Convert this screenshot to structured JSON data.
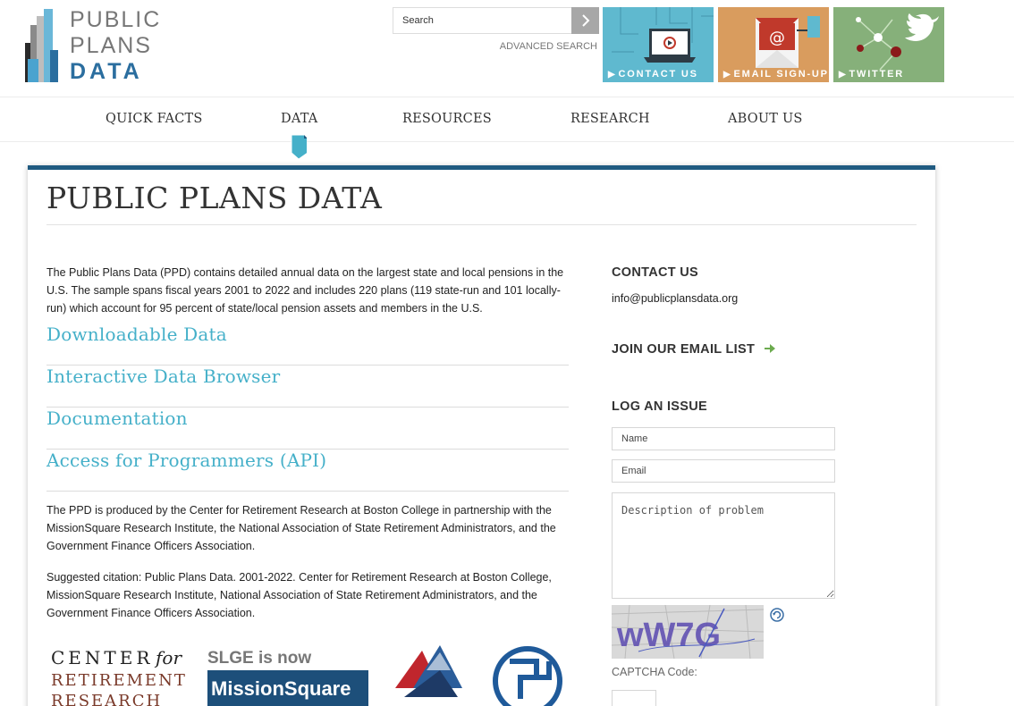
{
  "logo": {
    "line1": "PUBLIC",
    "line2": "PLANS",
    "line3": "DATA"
  },
  "search": {
    "placeholder": "Search",
    "advanced_label": "ADVANCED SEARCH"
  },
  "tiles": [
    {
      "label": "CONTACT US",
      "icon": "laptop-icon"
    },
    {
      "label": "EMAIL SIGN-UP",
      "icon": "envelope-icon"
    },
    {
      "label": "TWITTER",
      "icon": "twitter-bird-icon"
    }
  ],
  "nav": {
    "items": [
      "QUICK FACTS",
      "DATA",
      "RESOURCES",
      "RESEARCH",
      "ABOUT US"
    ],
    "active": "DATA"
  },
  "main": {
    "title": "PUBLIC PLANS DATA",
    "intro": "The Public Plans Data (PPD) contains detailed annual data on the largest state and local pensions in the U.S. The sample spans fiscal years 2001 to 2022 and includes 220 plans (119 state-run and 101 locally-run) which account for 95 percent of state/local pension assets and members in the U.S.",
    "links": [
      "Downloadable Data",
      "Interactive Data Browser",
      "Documentation",
      "Access for Programmers (API)"
    ],
    "credit": "The PPD is produced by the Center for Retirement Research at Boston College in partnership with the MissionSquare Research Institute, the National Association of State Retirement Administrators, and the Government Finance Officers Association.",
    "citation": "Suggested citation: Public Plans Data. 2001-2022. Center for Retirement Research at Boston College, MissionSquare Research Institute, National Association of State Retirement Administrators, and the Government Finance Officers Association.",
    "partner_logos": {
      "crr_line1": "CENTER",
      "crr_for": "for",
      "crr_line2": "RETIREMENT",
      "crr_line3": "RESEARCH",
      "slge_line1": "SLGE is now",
      "slge_line2": "MissionSquare"
    }
  },
  "sidebar": {
    "contact_heading": "CONTACT US",
    "contact_email": "info@publicplansdata.org",
    "join_label": "JOIN OUR EMAIL LIST",
    "issue_heading": "LOG AN ISSUE",
    "name_placeholder": "Name",
    "email_placeholder": "Email",
    "desc_placeholder": "Description of problem",
    "captcha_text": "wW7G",
    "captcha_label": "CAPTCHA Code:"
  },
  "colors": {
    "accent_blue": "#45b0c9",
    "panel_border": "#1f5a80",
    "logo_blue": "#2b6e9f",
    "arrow_green": "#6cab4f"
  }
}
